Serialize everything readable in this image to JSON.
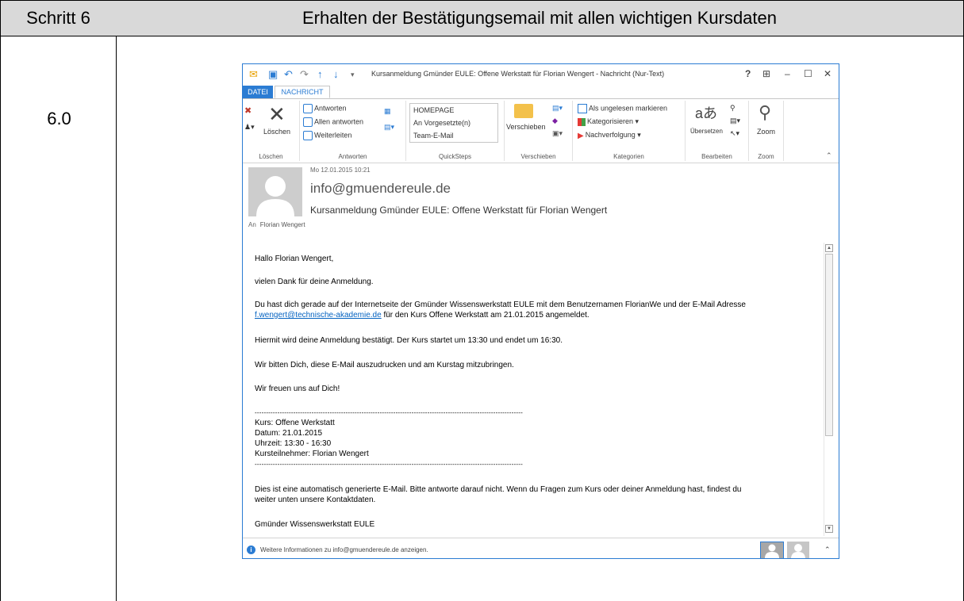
{
  "doc": {
    "step_label": "Schritt 6",
    "step_title": "Erhalten der Bestätigungsemail mit allen wichtigen Kursdaten",
    "step_number": "6.0"
  },
  "window": {
    "title": "Kursanmeldung Gmünder EULE: Offene Werkstatt für Florian Wengert - Nachricht (Nur-Text)",
    "controls": {
      "help": "?",
      "restore_ribbon": "⊞",
      "minimize": "–",
      "maximize": "☐",
      "close": "✕"
    }
  },
  "tabs": {
    "file": "DATEI",
    "message": "NACHRICHT"
  },
  "ribbon": {
    "delete_group": {
      "label": "Löschen",
      "delete": "Löschen"
    },
    "respond_group": {
      "label": "Antworten",
      "reply": "Antworten",
      "reply_all": "Allen antworten",
      "forward": "Weiterleiten"
    },
    "quicksteps_group": {
      "label": "QuickSteps",
      "items": [
        "HOMEPAGE",
        "An Vorgesetzte(n)",
        "Team-E-Mail"
      ]
    },
    "move_group": {
      "label": "Verschieben",
      "move": "Verschieben"
    },
    "tags_group": {
      "label": "Kategorien",
      "unread": "Als ungelesen markieren",
      "categorize": "Kategorisieren",
      "followup": "Nachverfolgung"
    },
    "editing_group": {
      "label": "Bearbeiten",
      "translate": "Übersetzen"
    },
    "zoom_group": {
      "label": "Zoom",
      "zoom": "Zoom"
    }
  },
  "message": {
    "date": "Mo 12.01.2015 10:21",
    "from": "info@gmuendereule.de",
    "subject": "Kursanmeldung Gmünder EULE: Offene Werkstatt für Florian Wengert",
    "to_label": "An",
    "to_name": "Florian Wengert"
  },
  "body": {
    "greeting": "Hallo Florian Wengert,",
    "thanks": "vielen Dank für deine Anmeldung.",
    "p1_line1": "Du hast dich gerade auf der Internetseite der Gmünder Wissenswerkstatt EULE mit dem Benutzernamen FlorianWe und der E-Mail Adresse",
    "p1_link": "f.wengert@technische-akademie.de",
    "p1_line2_rest": " für den Kurs Offene Werkstatt am 21.01.2015 angemeldet.",
    "confirm": "Hiermit wird deine Anmeldung bestätigt. Der Kurs startet um 13:30 und endet um 16:30.",
    "print": "Wir bitten Dich, diese E-Mail auszudrucken und am Kurstag mitzubringen.",
    "look_forward": "Wir freuen uns auf Dich!",
    "separator": "----------------------------------------------------------------------------------------------------------------------",
    "course": "Kurs: Offene Werkstatt",
    "date": "Datum: 21.01.2015",
    "time": "Uhrzeit: 13:30 - 16:30",
    "participant": "Kursteilnehmer: Florian Wengert",
    "auto_line1": "Dies ist eine automatisch generierte E-Mail. Bitte antworte darauf nicht. Wenn du Fragen zum Kurs oder deiner Anmeldung hast, findest du",
    "auto_line2": "weiter unten unsere Kontaktdaten.",
    "signature": "Gmünder Wissenswerkstatt EULE"
  },
  "footer": {
    "info": "Weitere Informationen zu info@gmuendereule.de anzeigen."
  }
}
